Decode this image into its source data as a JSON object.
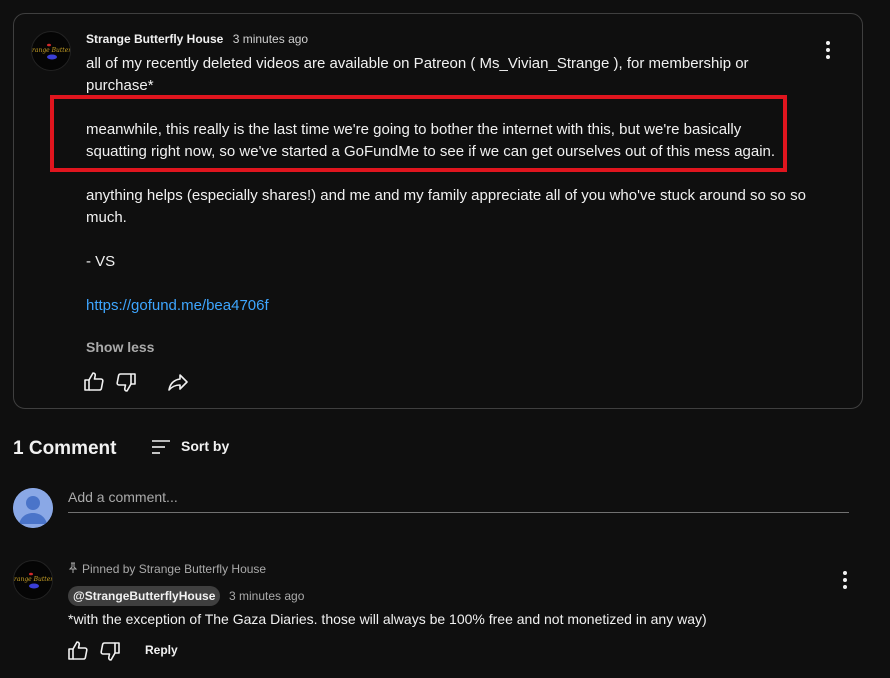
{
  "post": {
    "author": "Strange Butterfly House",
    "time": "3 minutes ago",
    "paragraph1": "all of my recently deleted videos are available on Patreon ( Ms_Vivian_Strange ), for membership or purchase*",
    "paragraph2": "meanwhile, this really is the last time we're going to bother the internet with this, but we're basically squatting right now, so we've started a GoFundMe to see if we can get ourselves out of this mess again.",
    "paragraph3": "anything helps (especially shares!) and me and my family appreciate all of you who've stuck around so so so much.",
    "signature": "- VS",
    "link": "https://gofund.me/bea4706f",
    "show_less_label": "Show less",
    "icons": {
      "avatar": "channel-avatar",
      "menu": "more-vert-icon",
      "like": "thumb-up-icon",
      "dislike": "thumb-down-icon",
      "share": "share-icon"
    }
  },
  "highlight": {
    "color": "#e0151e"
  },
  "comments": {
    "count_label": "1 Comment",
    "sort_label": "Sort by",
    "add_placeholder": "Add a comment...",
    "items": [
      {
        "pinned_label": "Pinned by Strange Butterfly House",
        "handle": "@StrangeButterflyHouse",
        "time": "3 minutes ago",
        "text": "*with the exception of The Gaza Diaries. those will always be 100% free and not monetized in any way)",
        "reply_label": "Reply"
      }
    ]
  },
  "theme": {
    "background": "#0f0f0f",
    "text": "#f1f1f1",
    "secondary_text": "#aaaaaa",
    "link": "#3ea6ff",
    "border": "#3f3f3f"
  }
}
